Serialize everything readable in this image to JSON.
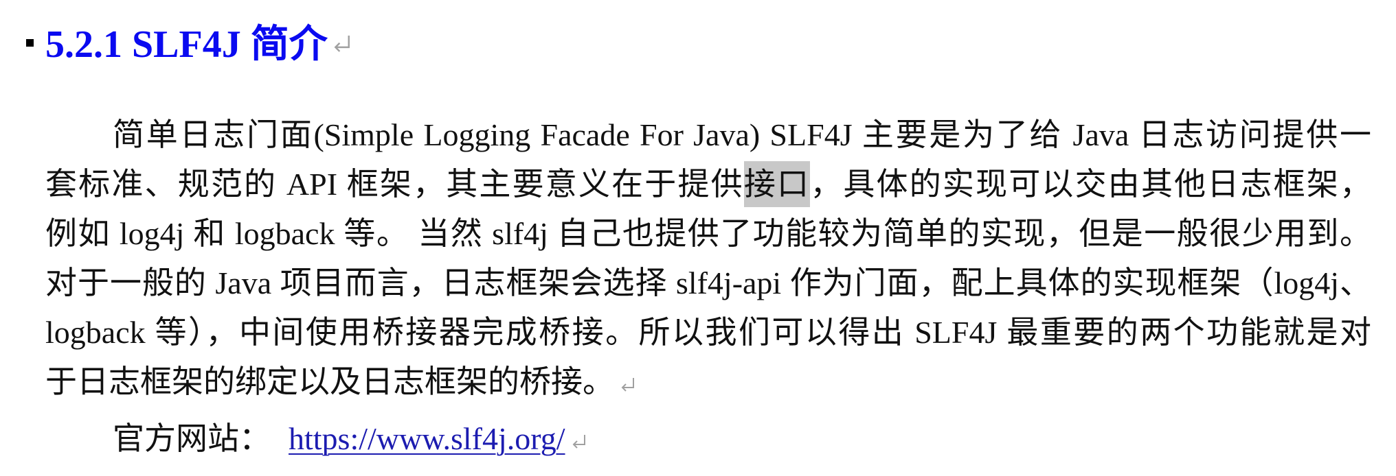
{
  "heading": {
    "bullet_icon": "square-bullet-icon",
    "text": "5.2.1 SLF4J 简介",
    "mark_icon": "paragraph-mark-icon"
  },
  "paragraph": {
    "line1": "简单日志门面(Simple Logging Facade For Java) SLF4J 主要是为了给 Java 日志访问提供一",
    "line2": {
      "before": "套标准、规范的 API 框架，其主要意义在于提供",
      "selected": "接口",
      "after": "，具体的实现可以交由其他日志框架，"
    },
    "line3": "例如 log4j 和 logback 等。 当然 slf4j 自己也提供了功能较为简单的实现，但是一般很少用到。",
    "line4": "对于一般的 Java 项目而言，日志框架会选择 slf4j-api 作为门面，配上具体的实现框架（log4j、",
    "line5": "logback 等），中间使用桥接器完成桥接。所以我们可以得出 SLF4J 最重要的两个功能就是对",
    "line6": "于日志框架的绑定以及日志框架的桥接。",
    "mark_icon": "paragraph-mark-icon"
  },
  "website": {
    "label": "官方网站：",
    "link_text": "https://www.slf4j.org/",
    "mark_icon": "paragraph-mark-icon"
  },
  "colors": {
    "text": "#111111",
    "heading": "#0a0af0",
    "link": "#1c1cb0",
    "selection": "#c8c8c8",
    "formatting_mark": "#a0a0a0"
  }
}
